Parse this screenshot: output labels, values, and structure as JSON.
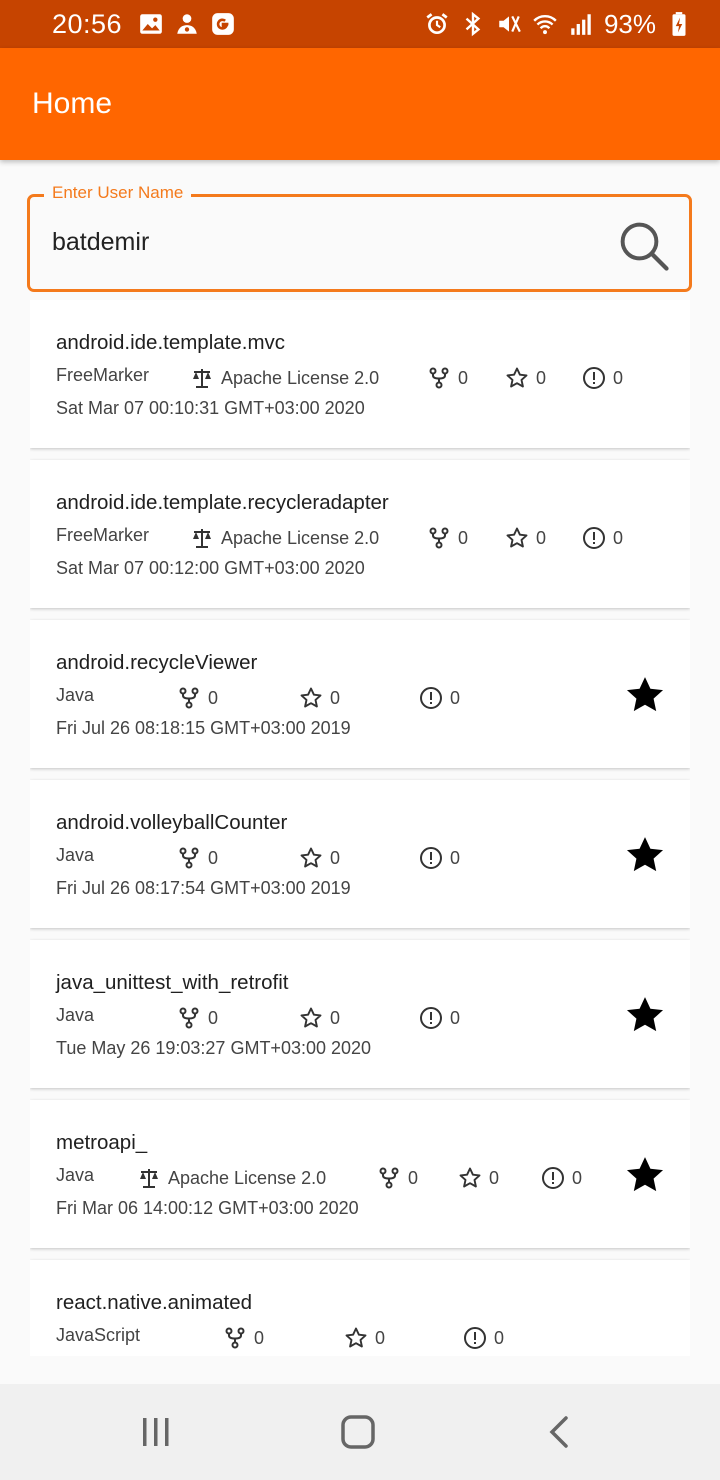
{
  "status_bar": {
    "time": "20:56",
    "battery": "93%",
    "left_icons": [
      "gallery-icon",
      "notification-app-icon",
      "google-icon"
    ],
    "right_icons": [
      "alarm-icon",
      "bluetooth-icon",
      "mute-icon",
      "wifi-icon",
      "signal-icon",
      "battery-charging-icon"
    ]
  },
  "app_bar": {
    "title": "Home"
  },
  "search": {
    "label": "Enter User Name",
    "value": "batdemir",
    "icon": "search-icon"
  },
  "colors": {
    "status_bar": "#c64400",
    "app_bar": "#ff6600",
    "accent": "#f47a1c",
    "star": "#000000"
  },
  "repos": [
    {
      "name": "android.ide.template.mvc",
      "language": "FreeMarker",
      "license": "Apache License 2.0",
      "forks": "0",
      "stars": "0",
      "issues": "0",
      "date": "Sat Mar 07 00:10:31 GMT+03:00 2020",
      "starred": false
    },
    {
      "name": "android.ide.template.recycleradapter",
      "language": "FreeMarker",
      "license": "Apache License 2.0",
      "forks": "0",
      "stars": "0",
      "issues": "0",
      "date": "Sat Mar 07 00:12:00 GMT+03:00 2020",
      "starred": false
    },
    {
      "name": "android.recycleViewer",
      "language": "Java",
      "license": "",
      "forks": "0",
      "stars": "0",
      "issues": "0",
      "date": "Fri Jul 26 08:18:15 GMT+03:00 2019",
      "starred": true
    },
    {
      "name": "android.volleyballCounter",
      "language": "Java",
      "license": "",
      "forks": "0",
      "stars": "0",
      "issues": "0",
      "date": "Fri Jul 26 08:17:54 GMT+03:00 2019",
      "starred": true
    },
    {
      "name": "java_unittest_with_retrofit",
      "language": "Java",
      "license": "",
      "forks": "0",
      "stars": "0",
      "issues": "0",
      "date": "Tue May 26 19:03:27 GMT+03:00 2020",
      "starred": true
    },
    {
      "name": "metroapi_",
      "language": "Java",
      "license": "Apache License 2.0",
      "forks": "0",
      "stars": "0",
      "issues": "0",
      "date": "Fri Mar 06 14:00:12 GMT+03:00 2020",
      "starred": true
    },
    {
      "name": "react.native.animated",
      "language": "JavaScript",
      "license": "",
      "forks": "0",
      "stars": "0",
      "issues": "0",
      "date": "",
      "starred": false
    }
  ],
  "nav_bar": {
    "icons": [
      "recent-apps-icon",
      "home-icon",
      "back-icon"
    ]
  }
}
